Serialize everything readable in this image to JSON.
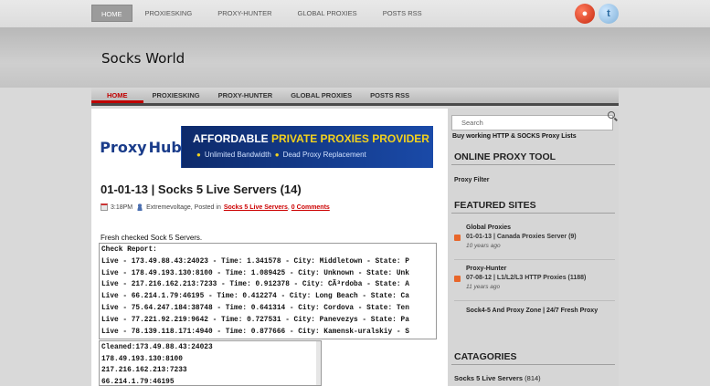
{
  "topnav": {
    "items": [
      "HOME",
      "PROXIESKING",
      "PROXY-HUNTER",
      "GLOBAL PROXIES",
      "POSTS RSS"
    ]
  },
  "social": {
    "rss_glyph": "●",
    "twitter_glyph": "t"
  },
  "site_title": "Socks World",
  "mainnav": {
    "items": [
      "HOME",
      "PROXIESKING",
      "PROXY-HUNTER",
      "GLOBAL PROXIES",
      "POSTS RSS"
    ]
  },
  "banner": {
    "logo_left": "Proxy",
    "logo_right": "Hub",
    "headline_plain": "AFFORDABLE ",
    "headline_highlight": "PRIVATE PROXIES PROVIDER",
    "feature_1": "Unlimited Bandwidth",
    "feature_2": "Dead Proxy Replacement"
  },
  "post": {
    "title": "01-01-13 | Socks 5 Live Servers (14)",
    "time": "3:18PM",
    "author": "Extremevoltage",
    "posted_in_label": ", Posted in",
    "category": "Socks 5 Live Servers",
    "comments": "0 Comments",
    "intro": "Fresh checked Sock 5 Servers.",
    "check_report": "Check Report:\nLive - 173.49.88.43:24023 - Time: 1.341578 - City: Middletown - State: P\nLive - 178.49.193.130:8100 - Time: 1.089425 - City: Unknown - State: Unk\nLive - 217.216.162.213:7233 - Time: 0.912378 - City: CÃ³rdoba - State: A\nLive - 66.214.1.79:46195 - Time: 0.412274 - City: Long Beach - State: Ca\nLive - 75.64.247.184:38748 - Time: 0.641314 - City: Cordova - State: Ten\nLive - 77.221.92.219:9642 - Time: 0.727531 - City: Panevezys - State: Pa\nLive - 78.139.118.171:4940 - Time: 0.877666 - City: Kamensk-uralskiy - S",
    "cleaned": "Cleaned:173.49.88.43:24023\n178.49.193.130:8100\n217.216.162.213:7233\n66.214.1.79:46195"
  },
  "sidebar": {
    "search_placeholder": "Search",
    "tagline": "Buy working HTTP & SOCKS Proxy Lists",
    "online_heading": "ONLINE PROXY TOOL",
    "proxy_filter": "Proxy Filter",
    "featured_heading": "FEATURED SITES",
    "featured": [
      {
        "name": "Global Proxies",
        "post": "01-01-13 | Canada Proxies Server (9)",
        "age": "10 years ago"
      },
      {
        "name": "Proxy-Hunter",
        "post": "07-08-12 | L1/L2/L3 HTTP Proxies (1188)",
        "age": "11 years ago"
      }
    ],
    "featured_3": "Sock4-5 And Proxy Zone | 24/7 Fresh Proxy",
    "categories_heading": "CATAGORIES",
    "category_name": "Socks 5 Live Servers",
    "category_count": " (814)"
  },
  "colors": {
    "accent": "#c00000",
    "banner_blue": "#0d2a6b",
    "banner_yellow": "#f3d21e"
  }
}
